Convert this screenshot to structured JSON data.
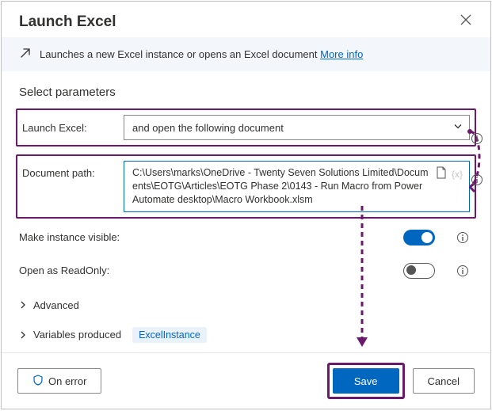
{
  "dialog": {
    "title": "Launch Excel"
  },
  "banner": {
    "text": "Launches a new Excel instance or opens an Excel document ",
    "link": "More info"
  },
  "section": "Select parameters",
  "fields": {
    "launch_label": "Launch Excel:",
    "launch_value": "and open the following document",
    "doc_label": "Document path:",
    "doc_value": "C:\\Users\\marks\\OneDrive - Twenty Seven Solutions Limited\\Documents\\EOTG\\Articles\\EOTG Phase 2\\0143 - Run Macro from Power Automate desktop\\Macro Workbook.xlsm",
    "visible_label": "Make instance visible:",
    "readonly_label": "Open as ReadOnly:"
  },
  "expanders": {
    "advanced": "Advanced",
    "variables": "Variables produced",
    "variable_chip": "ExcelInstance"
  },
  "footer": {
    "on_error": "On error",
    "save": "Save",
    "cancel": "Cancel"
  }
}
